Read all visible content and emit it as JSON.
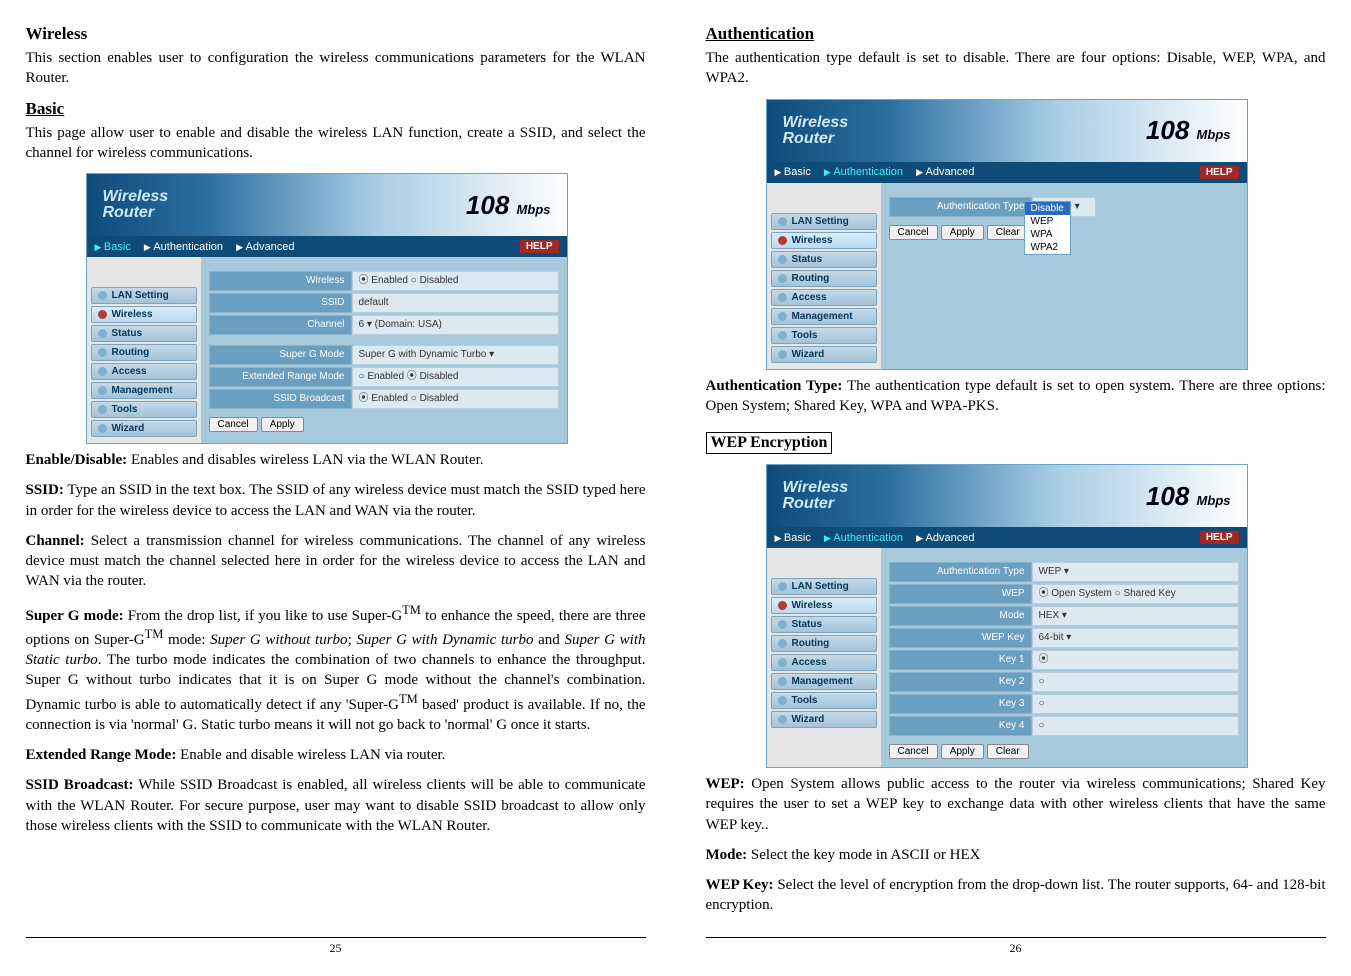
{
  "left": {
    "wireless_h": "Wireless",
    "wireless_p": "This section enables user to configuration the wireless communications parameters for the WLAN Router.",
    "basic_h": "Basic",
    "basic_p": "This page allow user to enable and disable the wireless LAN function, create a SSID, and select the channel for wireless communications.",
    "shot1": {
      "brand1": "Wireless",
      "brand2": "Router",
      "mbps": "108",
      "mbps_unit": "Mbps",
      "tab_basic": "Basic",
      "tab_auth": "Authentication",
      "tab_adv": "Advanced",
      "help": "HELP",
      "side": [
        "LAN Setting",
        "Wireless",
        "Status",
        "Routing",
        "Access",
        "Management",
        "Tools",
        "Wizard"
      ],
      "rows": [
        {
          "lab": "Wireless",
          "val": "⦿ Enabled  ○ Disabled"
        },
        {
          "lab": "SSID",
          "val": "default"
        },
        {
          "lab": "Channel",
          "val": "6 ▾  (Domain: USA)"
        },
        {
          "lab": "Super G Mode",
          "val": "Super G with Dynamic Turbo ▾"
        },
        {
          "lab": "Extended Range Mode",
          "val": "○ Enabled  ⦿ Disabled"
        },
        {
          "lab": "SSID Broadcast",
          "val": "⦿ Enabled  ○ Disabled"
        }
      ],
      "btn_cancel": "Cancel",
      "btn_apply": "Apply"
    },
    "enable_h": "Enable/Disable:",
    "enable_p": " Enables and disables wireless LAN via the WLAN Router.",
    "ssid_h": "SSID:",
    "ssid_p": " Type an SSID in the text box. The SSID of any wireless device must match the SSID typed here in order for the wireless device to access the LAN and WAN via the router.",
    "channel_h": "Channel:",
    "channel_p": " Select a transmission channel for wireless communications. The channel of any wireless device must match the channel selected here in order for the wireless device to access the LAN and WAN via the router.",
    "superg_h": "Super G mode:",
    "superg_p1": " From the drop list, if you like to use Super-G",
    "superg_tm": "TM",
    "superg_p2": " to enhance the speed, there are three options on Super-G",
    "superg_p3": " mode: ",
    "superg_i1": "Super G without turbo",
    "superg_semi": "; ",
    "superg_i2": "Super G with Dynamic turbo",
    "superg_and": " and ",
    "superg_i3": "Super G with Static turbo",
    "superg_p4": ".  The turbo mode indicates the combination of two channels to enhance the throughput.  Super G without turbo indicates that it is on Super G mode without the channel's combination.  Dynamic turbo is able to automatically detect if any 'Super-G",
    "superg_p5": " based' product is available. If no, the connection is via 'normal' G. Static turbo means it will not go back to 'normal' G once it starts.",
    "ext_h": "Extended Range Mode:",
    "ext_p": " Enable and disable wireless LAN via router.",
    "bcast_h": "SSID Broadcast:",
    "bcast_p": " While SSID Broadcast is enabled, all wireless clients will be able to communicate with the WLAN Router. For secure purpose, user may want to disable SSID broadcast to allow only those wireless clients with the SSID to communicate with the WLAN Router.",
    "pagenum": "25"
  },
  "right": {
    "auth_h": "Authentication",
    "auth_p": "The authentication type default is set to disable. There are four options: Disable, WEP, WPA, and WPA2.",
    "shot2": {
      "brand1": "Wireless",
      "brand2": "Router",
      "mbps": "108",
      "mbps_unit": "Mbps",
      "tab_basic": "Basic",
      "tab_auth": "Authentication",
      "tab_adv": "Advanced",
      "help": "HELP",
      "side": [
        "LAN Setting",
        "Wireless",
        "Status",
        "Routing",
        "Access",
        "Management",
        "Tools",
        "Wizard"
      ],
      "row_lab": "Authentication Type",
      "row_val": "Disable ▾",
      "dd": [
        "Disable",
        "WEP",
        "WPA",
        "WPA2"
      ],
      "btn_cancel": "Cancel",
      "btn_apply": "Apply",
      "btn_clear": "Clear"
    },
    "authtype_h": "Authentication Type:",
    "authtype_p": "  The authentication type default is set to open system. There are three options: Open System; Shared Key, WPA and WPA-PKS.",
    "wep_box": "WEP Encryption",
    "shot3": {
      "brand1": "Wireless",
      "brand2": "Router",
      "mbps": "108",
      "mbps_unit": "Mbps",
      "tab_basic": "Basic",
      "tab_auth": "Authentication",
      "tab_adv": "Advanced",
      "help": "HELP",
      "side": [
        "LAN Setting",
        "Wireless",
        "Status",
        "Routing",
        "Access",
        "Management",
        "Tools",
        "Wizard"
      ],
      "rows": [
        {
          "lab": "Authentication Type",
          "val": "WEP   ▾"
        },
        {
          "lab": "WEP",
          "val": "⦿ Open System  ○ Shared Key"
        },
        {
          "lab": "Mode",
          "val": "HEX  ▾"
        },
        {
          "lab": "WEP Key",
          "val": "64-bit ▾"
        },
        {
          "lab": "Key 1",
          "val": "⦿"
        },
        {
          "lab": "Key 2",
          "val": "○"
        },
        {
          "lab": "Key 3",
          "val": "○"
        },
        {
          "lab": "Key 4",
          "val": "○"
        }
      ],
      "btn_cancel": "Cancel",
      "btn_apply": "Apply",
      "btn_clear": "Clear"
    },
    "wep_h": "WEP:",
    "wep_p": " Open System allows public access to the router via wireless communications; Shared Key requires the user to set a WEP key to exchange data with other wireless clients that have the same WEP key..",
    "mode_h": "Mode:",
    "mode_p": " Select the key mode in ASCII or HEX",
    "wepkey_h": "WEP Key:",
    "wepkey_p": " Select the level of encryption from the drop-down list. The router supports, 64- and 128-bit encryption.",
    "pagenum": "26"
  }
}
